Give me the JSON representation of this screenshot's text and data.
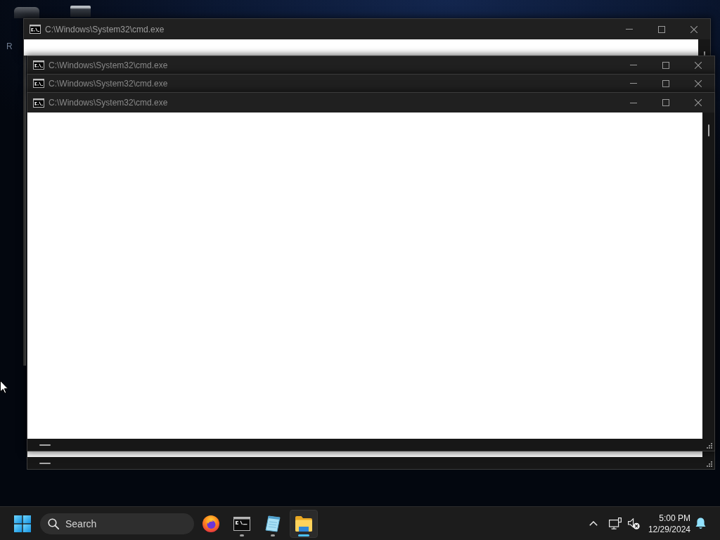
{
  "desktop": {
    "icon_labels": [
      "R"
    ]
  },
  "windows": [
    {
      "title": "C:\\Windows\\System32\\cmd.exe"
    },
    {
      "title": "C:\\Windows\\System32\\cmd.exe"
    },
    {
      "title": "C:\\Windows\\System32\\cmd.exe"
    },
    {
      "title": "C:\\Windows\\System32\\cmd.exe"
    }
  ],
  "taskbar": {
    "search": {
      "placeholder": "Search"
    },
    "apps": [
      {
        "kind": "browser",
        "running": false,
        "selected": false
      },
      {
        "kind": "terminal",
        "running": true,
        "selected": false
      },
      {
        "kind": "notepad",
        "running": true,
        "selected": false
      },
      {
        "kind": "folder",
        "running": true,
        "selected": true
      }
    ],
    "tray": {
      "volume_muted": true,
      "time": "5:00 PM",
      "date": "12/29/2024"
    }
  }
}
